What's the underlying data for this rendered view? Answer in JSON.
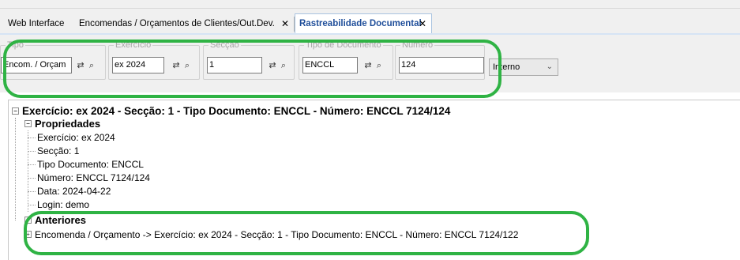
{
  "tabs": [
    {
      "label": "Web Interface",
      "closable": false
    },
    {
      "label": "Encomendas / Orçamentos de Clientes/Out.Dev.",
      "closable": true
    },
    {
      "label": "Rastreabilidade Documental",
      "closable": true,
      "active": true
    }
  ],
  "close_glyph": "✕",
  "filters": {
    "tipo": {
      "legend": "Tipo",
      "value": "Encom. / Orçam"
    },
    "exercicio": {
      "legend": "Exercício",
      "value": "ex 2024"
    },
    "seccao": {
      "legend": "Secção",
      "value": "1"
    },
    "tipo_documento": {
      "legend": "Tipo de Documento",
      "value": "ENCCL"
    },
    "numero": {
      "legend": "Número",
      "value": "124"
    },
    "scope_select": {
      "value": "Interno"
    }
  },
  "tree": {
    "root": "Exercício: ex 2024 - Secção: 1 - Tipo Documento: ENCCL - Número: ENCCL 7124/124",
    "propriedades": {
      "label": "Propriedades",
      "items": [
        "Exercício: ex 2024",
        "Secção: 1",
        "Tipo Documento: ENCCL",
        "Número: ENCCL 7124/124",
        "Data: 2024-04-22",
        "Login: demo"
      ]
    },
    "anteriores": {
      "label": "Anteriores",
      "items": [
        "Encomenda / Orçamento -> Exercício: ex 2024 - Secção: 1 - Tipo Documento: ENCCL - Número: ENCCL 7124/122"
      ]
    }
  },
  "colors": {
    "highlight": "#2fb344",
    "active_tab_text": "#1f4e9a"
  },
  "icons": [
    "binoculars-icon",
    "search-icon",
    "chevron-down-icon",
    "expand-icon",
    "collapse-icon"
  ]
}
